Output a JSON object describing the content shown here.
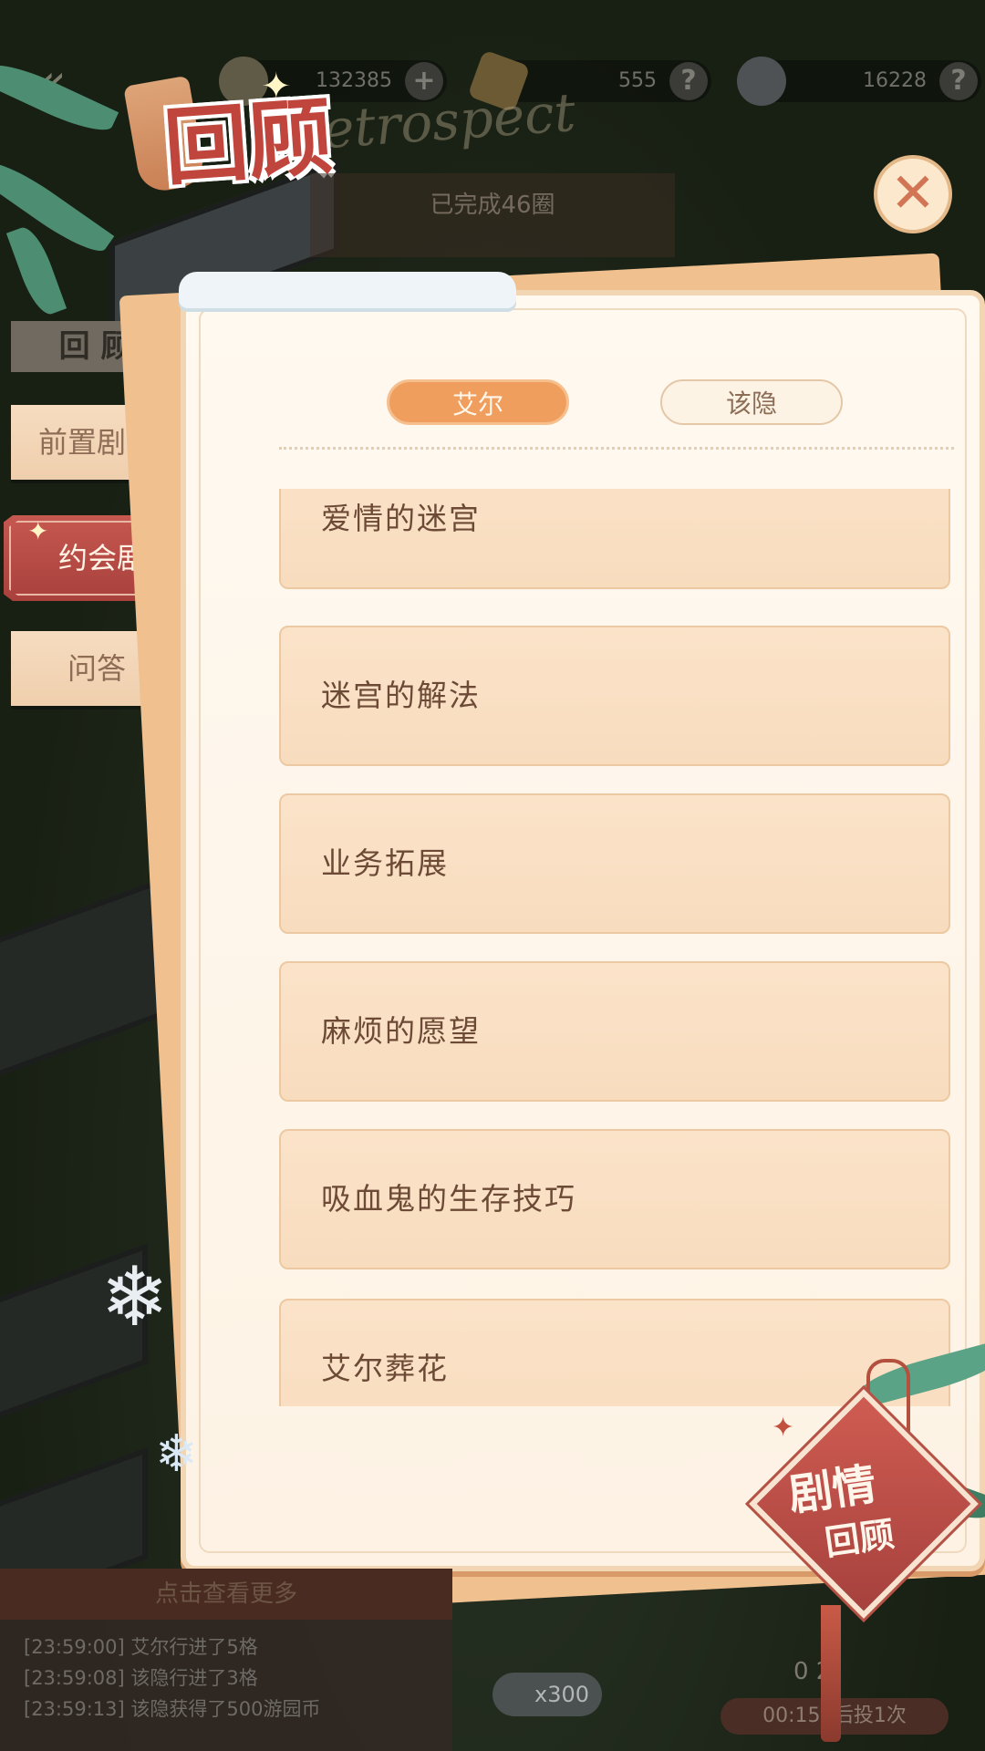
{
  "topbar": {
    "coins": "132385",
    "coins_btn": "+",
    "gems": "555",
    "gems_btn": "?",
    "tokens": "16228",
    "tokens_btn": "?"
  },
  "header": {
    "title": "回顾",
    "title_en": "Retrospect",
    "completed": "已完成46圈",
    "close_label": "✕"
  },
  "side": {
    "header": "回 顾",
    "tabs": [
      {
        "label": "前置剧情"
      },
      {
        "label": "约会剧情"
      },
      {
        "label": "问答"
      }
    ]
  },
  "characters": [
    "艾尔",
    "该隐"
  ],
  "stories": [
    {
      "label": "爱情的迷宫"
    },
    {
      "label": "迷宫的解法"
    },
    {
      "label": "业务拓展"
    },
    {
      "label": "麻烦的愿望"
    },
    {
      "label": "吸血鬼的生存技巧"
    },
    {
      "label": "艾尔葬花"
    }
  ],
  "badge": {
    "line1": "剧情",
    "line2": "回顾"
  },
  "log": {
    "header": "点击查看更多",
    "lines": [
      "[23:59:00]  艾尔行进了5格",
      "[23:59:08]  该隐行进了3格",
      "[23:59:13]  该隐获得了500游园币"
    ]
  },
  "hud": {
    "dice": "x300",
    "counter": "0 2",
    "timer": "00:15:  后投1次"
  }
}
